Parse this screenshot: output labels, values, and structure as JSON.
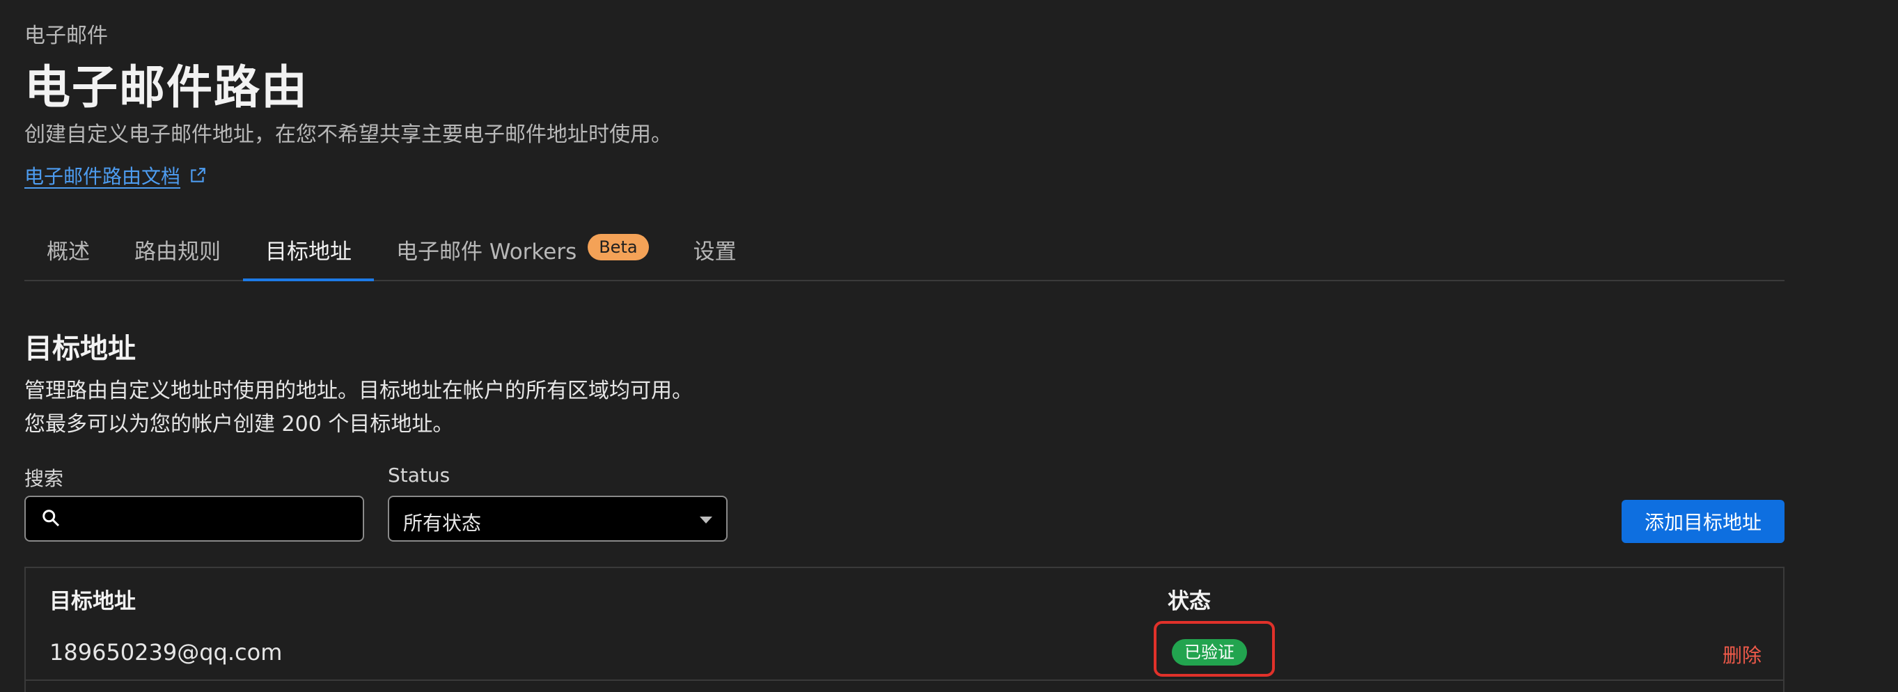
{
  "header": {
    "eyebrow": "电子邮件",
    "title": "电子邮件路由",
    "subtitle": "创建自定义电子邮件地址，在您不希望共享主要电子邮件地址时使用。",
    "doc_link": "电子邮件路由文档"
  },
  "tabs": [
    {
      "label": "概述"
    },
    {
      "label": "路由规则"
    },
    {
      "label": "目标地址",
      "active": true
    },
    {
      "label": "电子邮件 Workers",
      "badge": "Beta"
    },
    {
      "label": "设置"
    }
  ],
  "section": {
    "title": "目标地址",
    "desc_line1": "管理路由自定义地址时使用的地址。目标地址在帐户的所有区域均可用。",
    "desc_line2": "您最多可以为您的帐户创建 200 个目标地址。"
  },
  "filters": {
    "search_label": "搜索",
    "search_value": "",
    "status_label": "Status",
    "status_value": "所有状态"
  },
  "add_button": "添加目标地址",
  "table": {
    "columns": [
      "目标地址",
      "状态"
    ],
    "rows": [
      {
        "email": "189650239@qq.com",
        "status": "已验证",
        "action": "删除"
      }
    ]
  },
  "colors": {
    "accent": "#1d7ae6",
    "link": "#4d9cf0",
    "beta": "#f4a257",
    "verified": "#22a44f",
    "danger": "#ef5a4a",
    "highlight": "#e0312a"
  }
}
